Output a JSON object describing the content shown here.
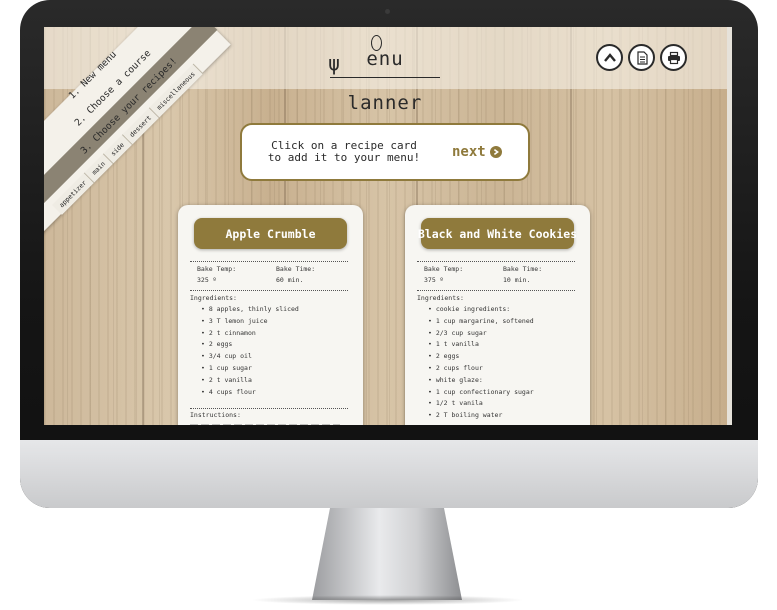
{
  "app": {
    "title": "Menu Planner",
    "logo_text": "enu  lanner"
  },
  "toolbar": {
    "top_icon": "chevron-up-icon",
    "document_icon": "document-icon",
    "print_icon": "print-icon"
  },
  "steps": [
    "1. New menu",
    "2. Choose a course",
    "3. Choose your recipes!"
  ],
  "course_tabs": [
    "appetizer",
    "main",
    "side",
    "dessert",
    "miscellaneous"
  ],
  "instruction": {
    "text_line1": "Click on a recipe card",
    "text_line2": "to add it to your menu!",
    "next_label": "next"
  },
  "cards": [
    {
      "title": "Apple Crumble",
      "bake_temp_label": "Bake Temp:",
      "bake_temp": "325 º",
      "bake_time_label": "Bake Time:",
      "bake_time": "60 min.",
      "ingredients_label": "Ingredients:",
      "ingredients": [
        "8 apples, thinly sliced",
        "3 T lemon juice",
        "2 t cinnamon",
        "2 eggs",
        "3/4 cup oil",
        "1 cup sugar",
        "2 t vanilla",
        "4 cups flour"
      ],
      "instructions_label": "Instructions:"
    },
    {
      "title": "Black and White Cookies",
      "bake_temp_label": "Bake Temp:",
      "bake_temp": "375 º",
      "bake_time_label": "Bake Time:",
      "bake_time": "10 min.",
      "ingredients_label": "Ingredients:",
      "ingredients": [
        "cookie ingredients:",
        "1 cup margarine, softened",
        "2/3 cup sugar",
        "1 t vanilla",
        "2 eggs",
        "2 cups flour",
        "white glaze:",
        "1 cup confectionary sugar",
        "1/2 t vanila",
        "2 T boiling water"
      ]
    }
  ],
  "colors": {
    "accent": "#8f7a3c",
    "card_bg": "#f7f6f2",
    "text": "#2a2a2a"
  }
}
